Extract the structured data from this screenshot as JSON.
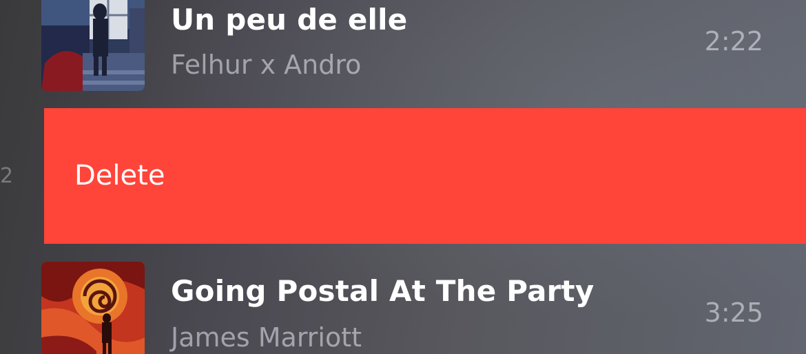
{
  "tracks": [
    {
      "title": "Un peu de elle",
      "artist": "Felhur x Andro",
      "duration": "2:22",
      "artwork_icon": "album-cover-room-scene"
    },
    {
      "title": "Going Postal At The Party",
      "artist": "James Marriott",
      "duration": "3:25",
      "artwork_icon": "album-cover-swirl-figure"
    }
  ],
  "swipe_action": {
    "label": "Delete",
    "color": "#ff453a"
  },
  "hidden_row_edge_text": "2"
}
